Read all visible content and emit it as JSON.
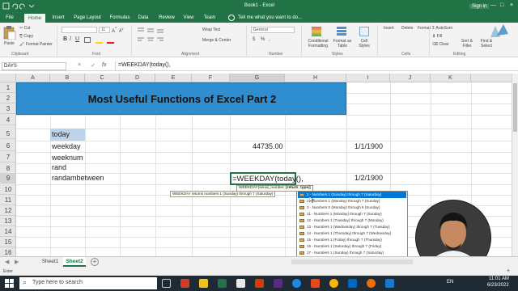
{
  "window": {
    "title": "Book1 - Excel",
    "user": "Sign in"
  },
  "tabs": [
    "File",
    "Home",
    "Insert",
    "Page Layout",
    "Formulas",
    "Data",
    "Review",
    "View",
    "Team"
  ],
  "tell_me": "Tell me what you want to do...",
  "ribbon": {
    "paste": "Paste",
    "cut": "Cut",
    "copy": "Copy",
    "format_painter": "Format Painter",
    "font_size": "11",
    "bold": "B",
    "italic": "I",
    "underline": "U",
    "wrap_text": "Wrap Text",
    "merge_center": "Merge & Center",
    "number_format": "General",
    "percent": "%",
    "comma": ",",
    "conditional": "Conditional Formatting",
    "format_table": "Format as Table",
    "cell_styles": "Cell Styles",
    "insert": "Insert",
    "delete": "Delete",
    "format": "Format",
    "autosum": "AutoSum",
    "fill": "Fill",
    "clear": "Clear",
    "sort_filter": "Sort & Filter",
    "find_select": "Find & Select",
    "groups": {
      "clipboard": "Clipboard",
      "font": "Font",
      "alignment": "Alignment",
      "number": "Number",
      "styles": "Styles",
      "cells": "Cells",
      "editing": "Editing"
    }
  },
  "formula_bar": {
    "name_box": "DAYS",
    "cancel": "×",
    "enter": "✓",
    "fx": "fx",
    "formula": "=WEEKDAY(today(),"
  },
  "columns": [
    "A",
    "B",
    "C",
    "D",
    "E",
    "F",
    "G",
    "H",
    "I",
    "J",
    "K"
  ],
  "rows": [
    "1",
    "2",
    "3",
    "4",
    "5",
    "6",
    "7",
    "8",
    "9",
    "10",
    "11",
    "12",
    "13",
    "14",
    "15",
    "16"
  ],
  "sheet": {
    "title": "Most Useful Functions of Excel Part 2",
    "b5": "today",
    "b6": "weekday",
    "b7": "weeknum",
    "b8": "rand",
    "b9": "randambetween",
    "g6": "44735.00",
    "i6": "1/1/1900",
    "i9": "1/2/1900",
    "g9": "=WEEKDAY(today(),"
  },
  "tooltip": {
    "prefix": "WEEKDAY(serial_number, ",
    "active": "[return_type]",
    ")": ")",
    "hint": "WEEKDAY returns numbers 1 (Sunday) through 7 (Saturday)"
  },
  "autocomplete": [
    "1 - Numbers 1 (Sunday) through 7 (Saturday)",
    "2 - Numbers 1 (Monday) through 7 (Sunday)",
    "3 - Numbers 0 (Monday) through 6 (Sunday)",
    "11 - Numbers 1 (Monday) through 7 (Sunday)",
    "12 - Numbers 1 (Tuesday) through 7 (Monday)",
    "13 - Numbers 1 (Wednesday) through 7 (Tuesday)",
    "14 - Numbers 1 (Thursday) through 7 (Wednesday)",
    "15 - Numbers 1 (Friday) through 7 (Thursday)",
    "16 - Numbers 1 (Saturday) through 7 (Friday)",
    "17 - Numbers 1 (Sunday) through 7 (Saturday)"
  ],
  "sheets": [
    "Sheet1",
    "Sheet2"
  ],
  "add_sheet": "+",
  "status": {
    "mode": "Enter",
    "zoom": "+"
  },
  "taskbar": {
    "search": "Type here to search",
    "lang": "EN",
    "time": "11:01 AM",
    "date": "6/23/2022"
  },
  "colors": {
    "excel_green": "#217346",
    "title_fill": "#2e8ecf",
    "selection": "#bcd3ea"
  }
}
